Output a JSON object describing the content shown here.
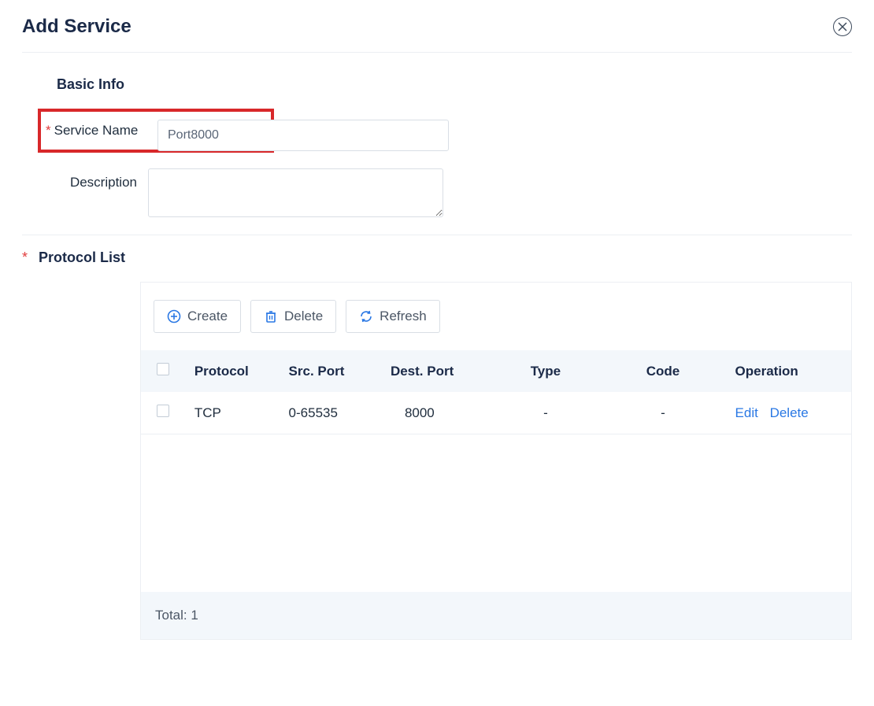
{
  "modal": {
    "title": "Add Service"
  },
  "basic_info": {
    "section_title": "Basic Info",
    "service_name_label": "Service Name",
    "service_name_value": "Port8000",
    "description_label": "Description",
    "description_value": ""
  },
  "protocol_list": {
    "section_title": "Protocol List",
    "toolbar": {
      "create": "Create",
      "delete": "Delete",
      "refresh": "Refresh"
    },
    "columns": {
      "protocol": "Protocol",
      "src_port": "Src. Port",
      "dest_port": "Dest. Port",
      "type": "Type",
      "code": "Code",
      "operation": "Operation"
    },
    "rows": [
      {
        "protocol": "TCP",
        "src_port": "0-65535",
        "dest_port": "8000",
        "type": "-",
        "code": "-",
        "edit": "Edit",
        "delete": "Delete"
      }
    ],
    "footer_total_label": "Total: ",
    "footer_total_value": "1"
  }
}
